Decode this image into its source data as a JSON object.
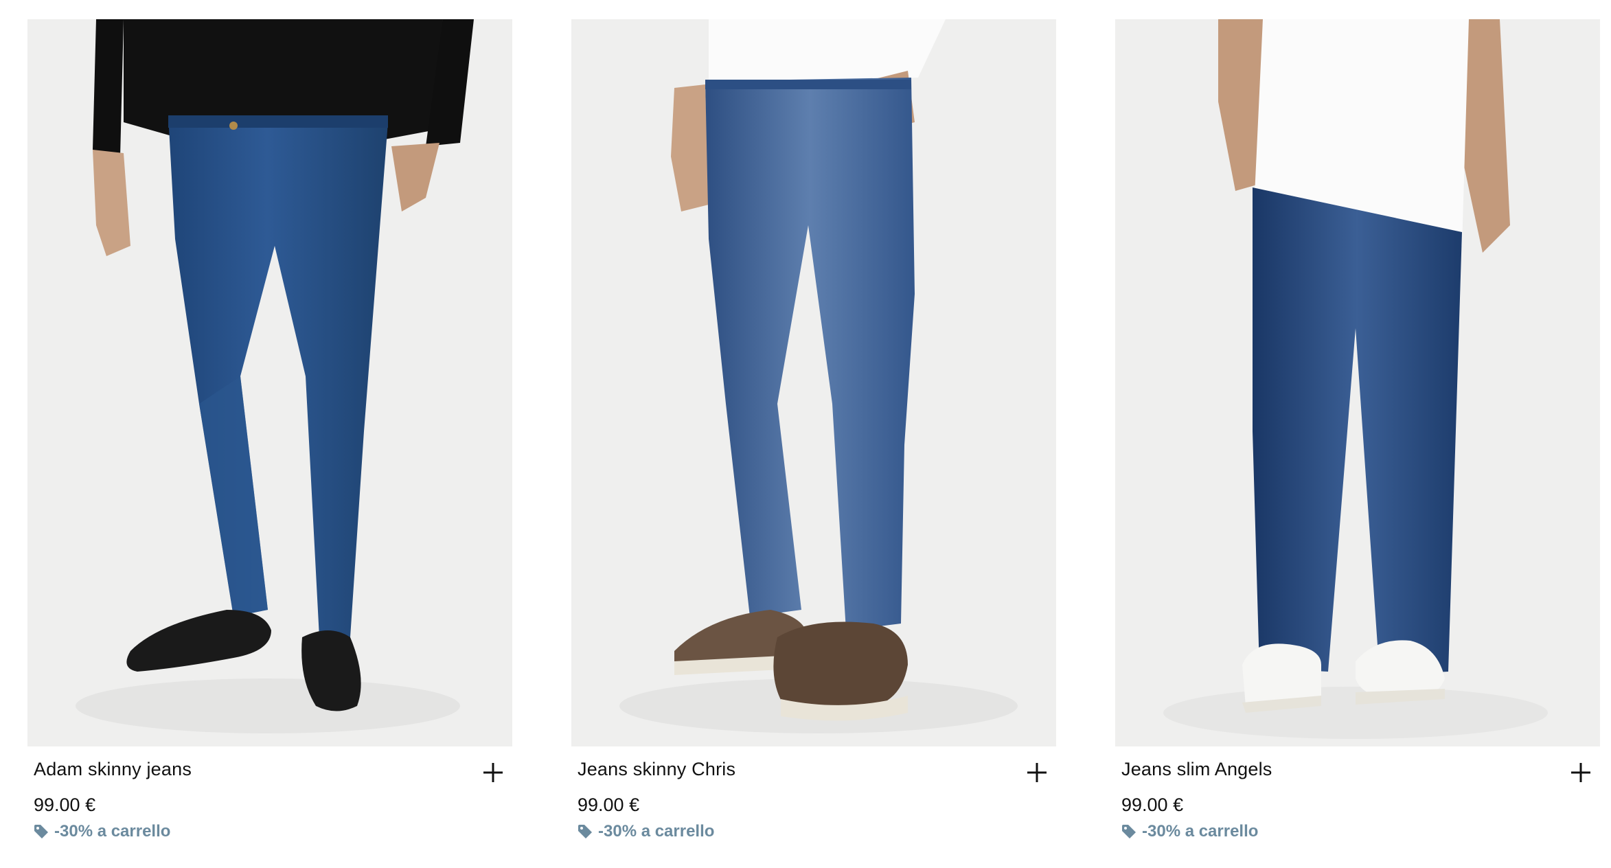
{
  "products": [
    {
      "name": "Adam skinny jeans",
      "price": "99.00 €",
      "promo": "-30% a carrello",
      "image": "man wearing dark blue skinny jeans, black sweater, black loafers",
      "top_color": "#141414",
      "shoe_color": "#1c1c1c",
      "jeans_color": "#274f86"
    },
    {
      "name": "Jeans skinny Chris",
      "price": "99.00 €",
      "promo": "-30% a carrello",
      "image": "man wearing faded blue skinny jeans, white t-shirt, brown boat shoes",
      "top_color": "#f7f7f7",
      "shoe_color": "#6b5443",
      "jeans_color": "#3e5f90"
    },
    {
      "name": "Jeans slim Angels",
      "price": "99.00 €",
      "promo": "-30% a carrello",
      "image": "man wearing dark blue slim jeans, white t-shirt, white sneakers",
      "top_color": "#fafafa",
      "shoe_color": "#f4f4f2",
      "jeans_color": "#1f3f74"
    }
  ],
  "icons": {
    "add": "plus-icon",
    "promo": "tag-icon"
  },
  "colors": {
    "promo_text": "#6b8a9e",
    "text": "#111111",
    "image_bg": "#eeeeed"
  }
}
